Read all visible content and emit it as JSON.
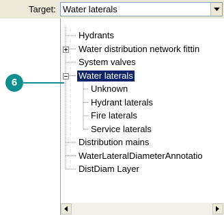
{
  "target": {
    "label": "Target:",
    "value": "Water laterals"
  },
  "callout": {
    "number": "6",
    "color": "#0d8f8e"
  },
  "tree": [
    {
      "label": "Hydrants",
      "level": 0,
      "expander": "none"
    },
    {
      "label": "Water distribution network fittin",
      "level": 0,
      "expander": "plus"
    },
    {
      "label": "System valves",
      "level": 0,
      "expander": "none"
    },
    {
      "label": "Water laterals",
      "level": 0,
      "expander": "minus",
      "selected": true
    },
    {
      "label": "Unknown",
      "level": 1,
      "expander": "none"
    },
    {
      "label": "Hydrant laterals",
      "level": 1,
      "expander": "none"
    },
    {
      "label": "Fire laterals",
      "level": 1,
      "expander": "none"
    },
    {
      "label": "Service laterals",
      "level": 1,
      "expander": "none"
    },
    {
      "label": "Distribution mains",
      "level": 0,
      "expander": "none"
    },
    {
      "label": "WaterLateralDiameterAnnotatio",
      "level": 0,
      "expander": "none"
    },
    {
      "label": "DistDiam Layer",
      "level": 0,
      "expander": "none"
    }
  ]
}
